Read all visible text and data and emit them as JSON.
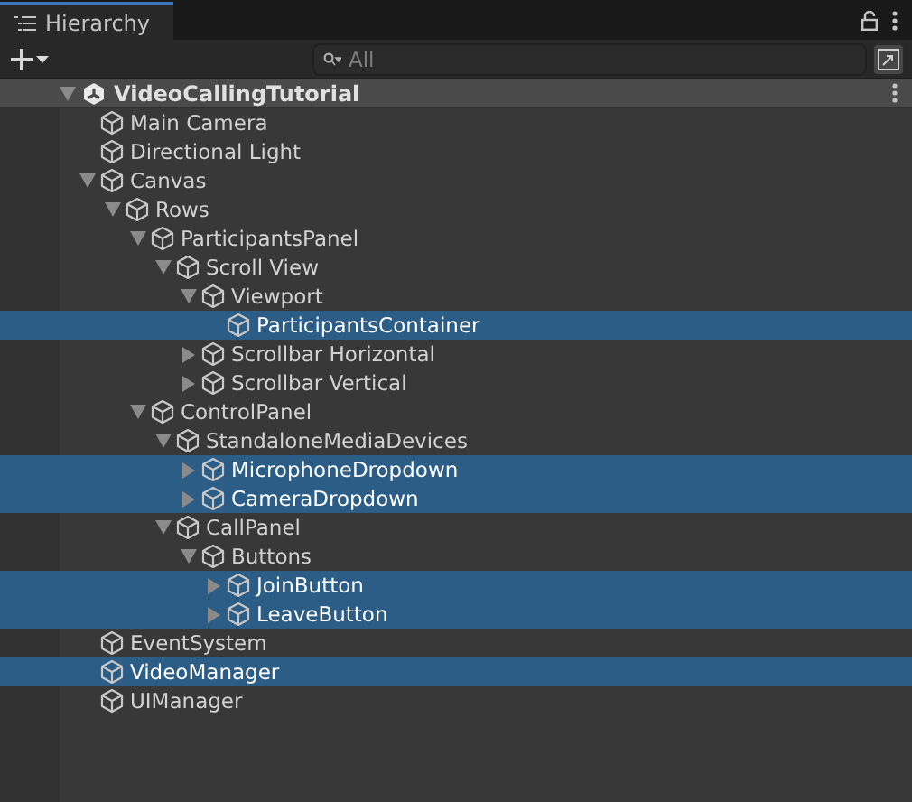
{
  "tab": {
    "label": "Hierarchy",
    "selected": true
  },
  "search": {
    "placeholder": "All"
  },
  "scene": {
    "name": "VideoCallingTutorial",
    "expanded": true
  },
  "items": [
    {
      "name": "Main Camera",
      "kind": "leaf",
      "selected": false
    },
    {
      "name": "Directional Light",
      "kind": "leaf",
      "selected": false
    },
    {
      "name": "Canvas",
      "kind": "branch",
      "expanded": true,
      "selected": false,
      "children": [
        {
          "name": "Rows",
          "kind": "branch",
          "expanded": true,
          "selected": false,
          "children": [
            {
              "name": "ParticipantsPanel",
              "kind": "branch",
              "expanded": true,
              "selected": false,
              "children": [
                {
                  "name": "Scroll View",
                  "kind": "branch",
                  "expanded": true,
                  "selected": false,
                  "children": [
                    {
                      "name": "Viewport",
                      "kind": "branch",
                      "expanded": true,
                      "selected": false,
                      "children": [
                        {
                          "name": "ParticipantsContainer",
                          "kind": "leaf",
                          "selected": true
                        }
                      ]
                    },
                    {
                      "name": "Scrollbar Horizontal",
                      "kind": "branch",
                      "expanded": false,
                      "selected": false
                    },
                    {
                      "name": "Scrollbar Vertical",
                      "kind": "branch",
                      "expanded": false,
                      "selected": false
                    }
                  ]
                }
              ]
            },
            {
              "name": "ControlPanel",
              "kind": "branch",
              "expanded": true,
              "selected": false,
              "children": [
                {
                  "name": "StandaloneMediaDevices",
                  "kind": "branch",
                  "expanded": true,
                  "selected": false,
                  "children": [
                    {
                      "name": "MicrophoneDropdown",
                      "kind": "branch",
                      "expanded": false,
                      "selected": true
                    },
                    {
                      "name": "CameraDropdown",
                      "kind": "branch",
                      "expanded": false,
                      "selected": true
                    }
                  ]
                },
                {
                  "name": "CallPanel",
                  "kind": "branch",
                  "expanded": true,
                  "selected": false,
                  "children": [
                    {
                      "name": "Buttons",
                      "kind": "branch",
                      "expanded": true,
                      "selected": false,
                      "children": [
                        {
                          "name": "JoinButton",
                          "kind": "branch",
                          "expanded": false,
                          "selected": true
                        },
                        {
                          "name": "LeaveButton",
                          "kind": "branch",
                          "expanded": false,
                          "selected": true
                        }
                      ]
                    }
                  ]
                }
              ]
            }
          ]
        }
      ]
    },
    {
      "name": "EventSystem",
      "kind": "leaf",
      "selected": false
    },
    {
      "name": "VideoManager",
      "kind": "leaf",
      "selected": true
    },
    {
      "name": "UIManager",
      "kind": "leaf",
      "selected": false
    }
  ]
}
